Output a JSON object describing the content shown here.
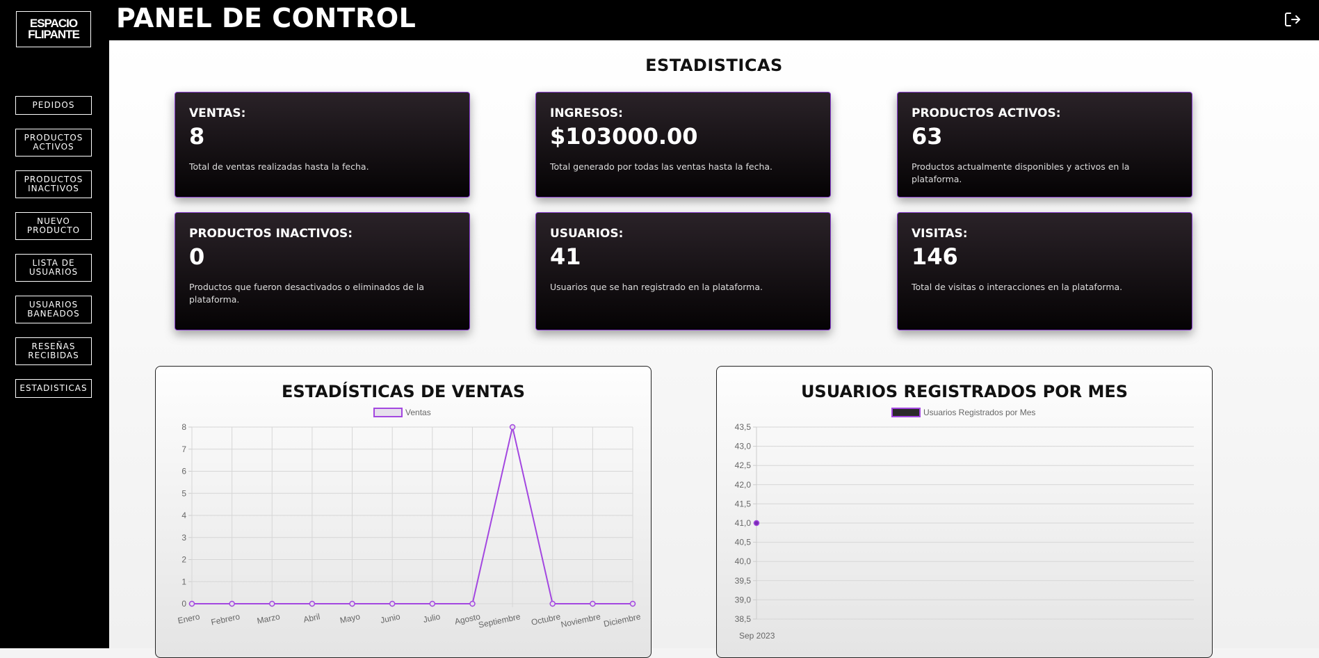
{
  "brand": {
    "line1": "ESPACIO",
    "line2": "FLIPANTE"
  },
  "header": {
    "title": "PANEL DE CONTROL"
  },
  "nav": [
    {
      "label": "PEDIDOS"
    },
    {
      "label": "PRODUCTOS ACTIVOS"
    },
    {
      "label": "PRODUCTOS INACTIVOS"
    },
    {
      "label": "NUEVO PRODUCTO"
    },
    {
      "label": "LISTA DE USUARIOS"
    },
    {
      "label": "USUARIOS BANEADOS"
    },
    {
      "label": "RESEÑAS RECIBIDAS"
    },
    {
      "label": "ESTADISTICAS"
    }
  ],
  "stats": {
    "title": "ESTADISTICAS",
    "cards": [
      {
        "label": "VENTAS:",
        "value": "8",
        "desc": "Total de ventas realizadas hasta la fecha."
      },
      {
        "label": "INGRESOS:",
        "value": "$103000.00",
        "desc": "Total generado por todas las ventas hasta la fecha."
      },
      {
        "label": "PRODUCTOS ACTIVOS:",
        "value": "63",
        "desc": "Productos actualmente disponibles y activos en la plataforma."
      },
      {
        "label": "PRODUCTOS INACTIVOS:",
        "value": "0",
        "desc": "Productos que fueron desactivados o eliminados de la plataforma."
      },
      {
        "label": "USUARIOS:",
        "value": "41",
        "desc": "Usuarios que se han registrado en la plataforma."
      },
      {
        "label": "VISITAS:",
        "value": "146",
        "desc": "Total de visitas o interacciones en la plataforma."
      }
    ]
  },
  "colors": {
    "accent": "#a347e0",
    "card_border": "#8a3fd1"
  },
  "chart_data": [
    {
      "type": "line",
      "title": "ESTADÍSTICAS DE VENTAS",
      "categories": [
        "Enero",
        "Febrero",
        "Marzo",
        "Abril",
        "Mayo",
        "Junio",
        "Julio",
        "Agosto",
        "Septiembre",
        "Octubre",
        "Noviembre",
        "Diciembre"
      ],
      "series": [
        {
          "name": "Ventas",
          "values": [
            0,
            0,
            0,
            0,
            0,
            0,
            0,
            0,
            8,
            0,
            0,
            0
          ]
        }
      ],
      "ylim": [
        0,
        8
      ],
      "yticks": [
        "0",
        "1",
        "2",
        "3",
        "4",
        "5",
        "6",
        "7",
        "8"
      ],
      "grid": true,
      "legend": "top"
    },
    {
      "type": "line",
      "title": "USUARIOS REGISTRADOS POR MES",
      "categories": [
        "Sep 2023"
      ],
      "series": [
        {
          "name": "Usuarios Registrados por Mes",
          "values": [
            41
          ]
        }
      ],
      "ylim": [
        38.5,
        43.5
      ],
      "yticks": [
        "38,5",
        "39,0",
        "39,5",
        "40,0",
        "40,5",
        "41,0",
        "41,5",
        "42,0",
        "42,5",
        "43,0",
        "43,5"
      ],
      "grid": true,
      "legend": "top"
    }
  ]
}
